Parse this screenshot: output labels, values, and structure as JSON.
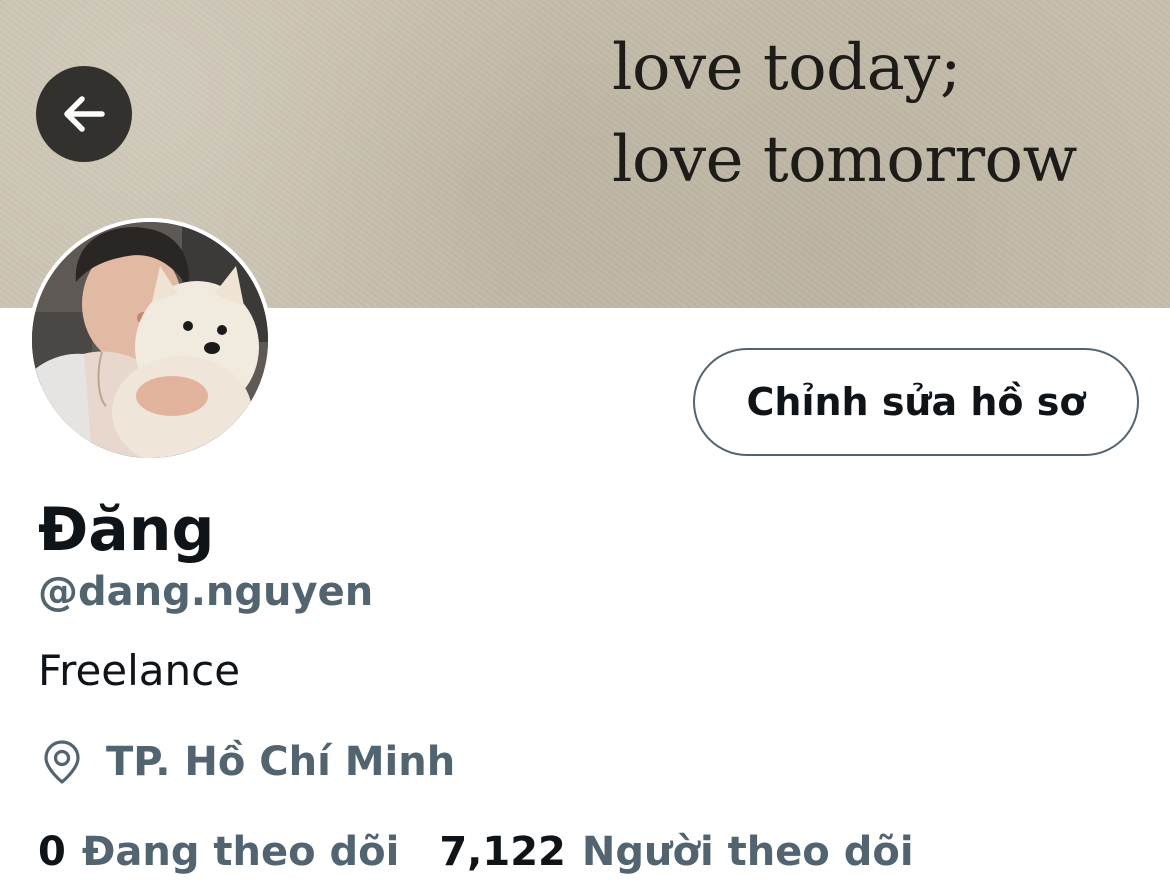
{
  "banner": {
    "quote_line1": "love today;",
    "quote_line2": "love tomorrow"
  },
  "nav": {
    "back_icon": "arrow-left-icon"
  },
  "profile": {
    "edit_button_label": "Chỉnh sửa hồ sơ",
    "display_name": "Đăng",
    "handle": "@dang.nguyen",
    "bio": "Freelance",
    "location_icon": "location-pin-icon",
    "location": "TP. Hồ Chí Minh"
  },
  "stats": {
    "following_count": "0",
    "following_label": "Đang theo dõi",
    "followers_count": "7,122",
    "followers_label": "Người theo dõi"
  },
  "colors": {
    "text_primary": "#0f1419",
    "text_secondary": "#536471",
    "banner_paper": "#c7bfad",
    "back_button_bg": "#33312e"
  }
}
